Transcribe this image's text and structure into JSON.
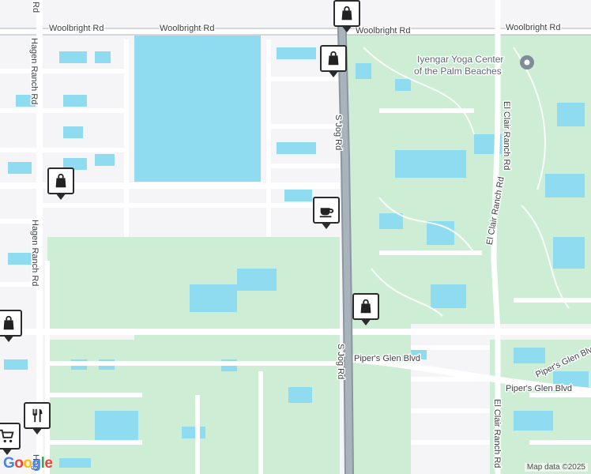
{
  "map": {
    "background_color": "#f5f4f7",
    "water_color": "#8fdcf0",
    "green_color": "#cdeed5",
    "road_color": "#ffffff",
    "highway_color": "#9aa5b1"
  },
  "roads": {
    "woolbright_1": "Woolbright Rd",
    "woolbright_2": "Woolbright Rd",
    "woolbright_3": "Woolbright Rd",
    "woolbright_4": "Woolbright Rd",
    "hagen_ranch_1": "Hagen Ranch Rd",
    "hagen_ranch_2": "Hagen Ranch Rd",
    "hagen_ranch_3": "Hag",
    "hagen_ranch_top": "Rd",
    "s_jog_1": "S Jog Rd",
    "s_jog_2": "S Jog Rd",
    "el_clair_1": "El Clair Ranch Rd",
    "el_clair_2": "El Clair Ranch Rd",
    "el_clair_3": "El Clair Ranch Rd",
    "pipers_1": "Piper's Glen Blvd",
    "pipers_2": "Piper's Glen Blvd",
    "pipers_3": "Piper's Glen Blvd"
  },
  "poi": {
    "yoga_line1": "Iyengar Yoga Center",
    "yoga_line2": "of the Palm Beaches",
    "yoga_icon": "pin-icon"
  },
  "markers": [
    {
      "icon": "shopping-bag-icon"
    },
    {
      "icon": "shopping-bag-icon"
    },
    {
      "icon": "shopping-bag-icon"
    },
    {
      "icon": "coffee-cup-icon"
    },
    {
      "icon": "shopping-bag-icon"
    },
    {
      "icon": "shopping-bag-icon"
    },
    {
      "icon": "restaurant-icon"
    },
    {
      "icon": "shopping-cart-icon"
    }
  ],
  "footer": {
    "attribution": "Map data ©2025",
    "logo": "Google"
  }
}
